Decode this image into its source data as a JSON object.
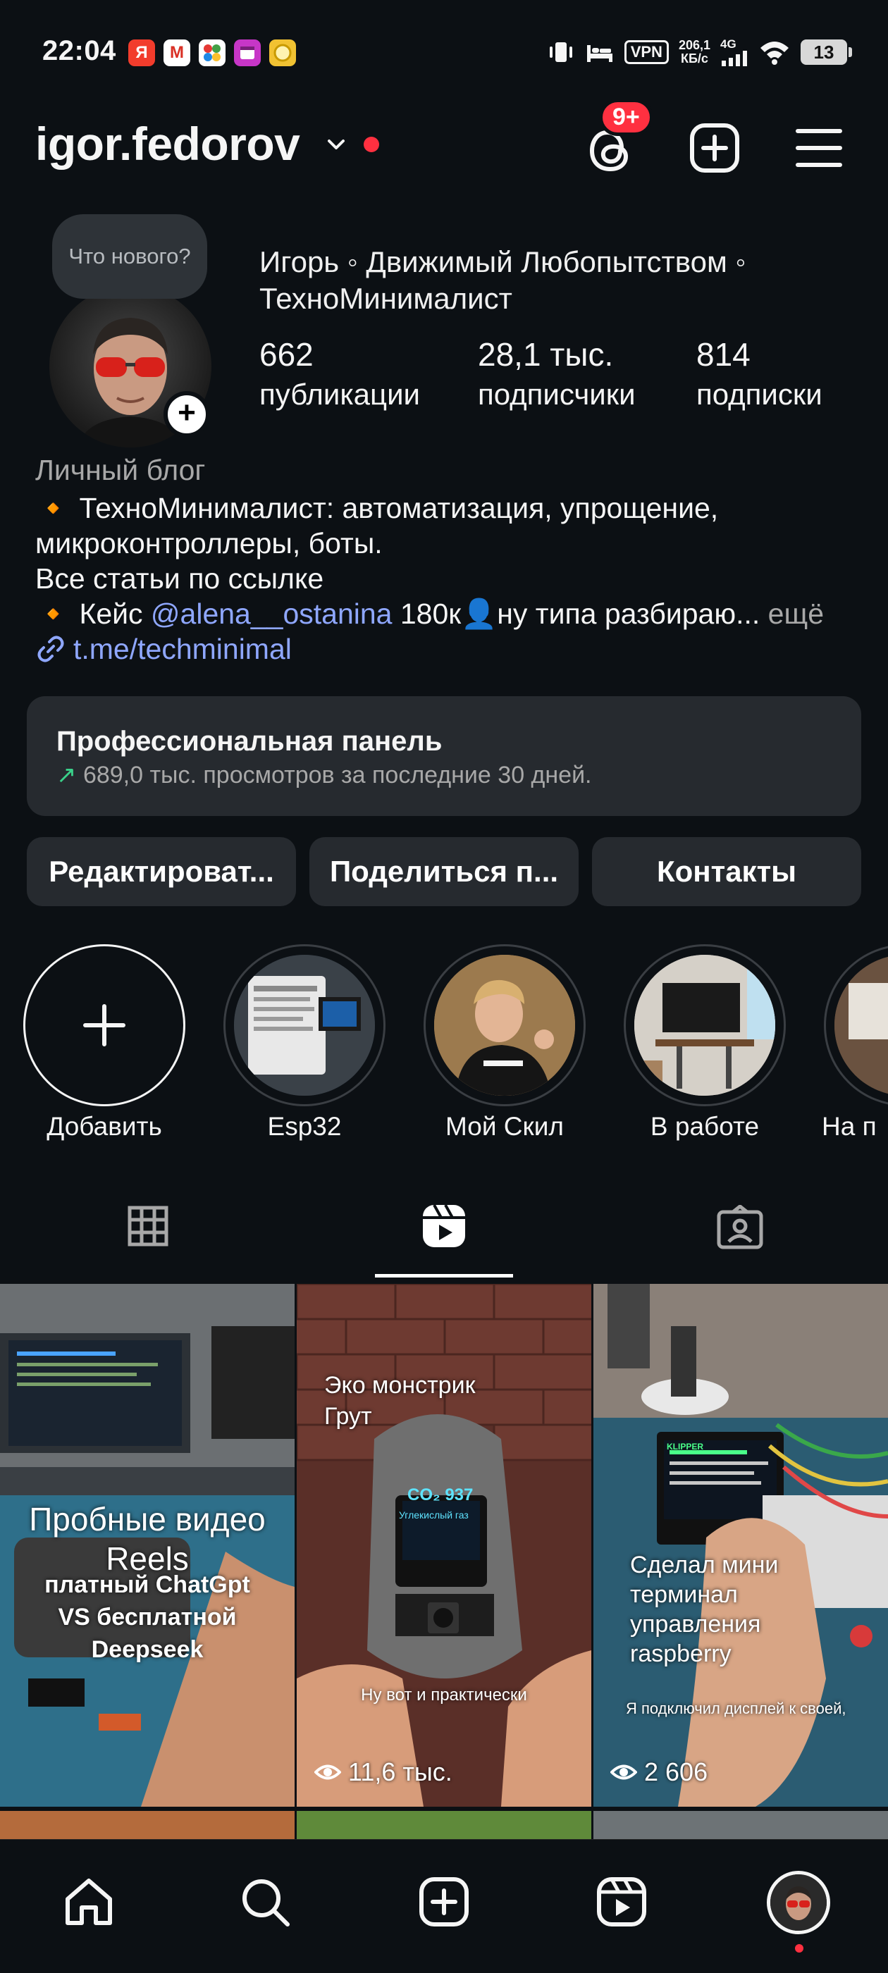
{
  "status_bar": {
    "time": "22:04",
    "apps": [
      {
        "name": "yandex-icon",
        "label": "Я",
        "color": "#f23c2c"
      },
      {
        "name": "gmail-icon",
        "label": "M",
        "color": "#ffffff"
      },
      {
        "name": "grid-app-icon",
        "label": "",
        "color": "#ffffff"
      },
      {
        "name": "calendar-app-icon",
        "label": "",
        "color": "#c736c7"
      },
      {
        "name": "coin-app-icon",
        "label": "",
        "color": "#f1c232"
      }
    ],
    "vpn": "VPN",
    "speed_value": "206,1",
    "speed_unit": "КБ/с",
    "network": "4G",
    "battery": "13"
  },
  "header": {
    "username": "igor.fedorov",
    "threads_badge": "9+"
  },
  "profile": {
    "note_bubble": "Что нового?",
    "display_name": "Игорь ◦ Движимый Любопытством ◦ ТехноМинималист",
    "stats": [
      {
        "value": "662",
        "label": "публикации"
      },
      {
        "value": "28,1 тыс.",
        "label": "подписчики"
      },
      {
        "value": "814",
        "label": "подписки"
      }
    ],
    "category": "Личный блог",
    "bio_line1": "🔸 ТехноМинималист: автоматизация, упрощение,",
    "bio_line2": "микроконтроллеры, боты.",
    "bio_line3": "Все статьи по ссылке",
    "bio_line4_prefix": "🔸 Кейс ",
    "bio_line4_mention": "@alena__ostanina",
    "bio_line4_suffix": " 180к👤ну типа разбираю...",
    "bio_more": " ещё",
    "link": "t.me/techminimal"
  },
  "pro_panel": {
    "title": "Профессиональная панель",
    "arrow": "↗",
    "subtitle": "689,0 тыс. просмотров за последние 30 дней."
  },
  "buttons": {
    "edit": "Редактироват...",
    "share": "Поделиться п...",
    "contacts": "Контакты"
  },
  "highlights": [
    {
      "label": "Добавить"
    },
    {
      "label": "Esp32"
    },
    {
      "label": "Мой Скил"
    },
    {
      "label": "В работе"
    },
    {
      "label": "На п"
    }
  ],
  "reels": [
    {
      "title": "Пробные видео Reels",
      "caption": "платный ChatGpt VS бесплатной Deepseek",
      "views": ""
    },
    {
      "title": "Эко монстрик Грут",
      "caption": "Ну вот и практически",
      "screen_text": "CO₂ 937",
      "screen_sub": "Углекислый газ",
      "views": "11,6 тыс."
    },
    {
      "title": "Сделал мини терминал управления raspberry",
      "caption": "Я подключил дисплей к своей,",
      "screen_text": "KLIPPER",
      "views": "2 606"
    }
  ]
}
